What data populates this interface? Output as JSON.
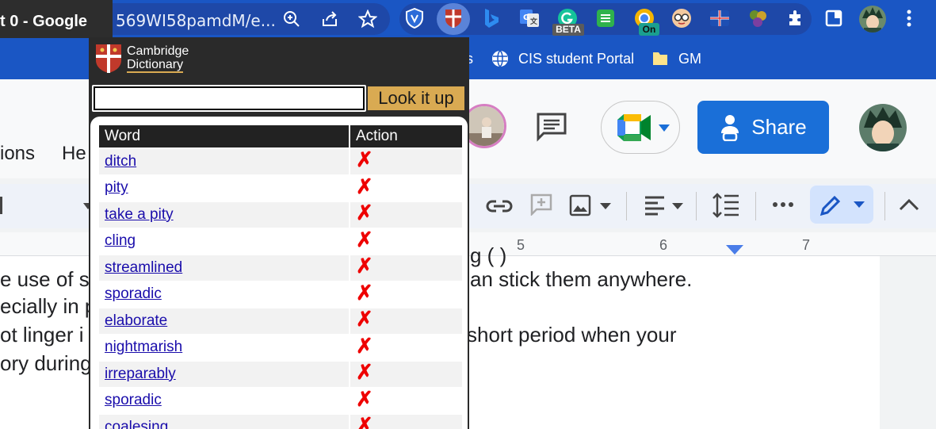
{
  "browser": {
    "tab_title": "t 0 - Google",
    "url_fragment": "569WI58pamdM/e...",
    "extension_badges": {
      "beta": "BETA",
      "on": "On"
    }
  },
  "bookmarks": [
    {
      "label": "s"
    },
    {
      "label": "CIS student Portal",
      "icon": "globe-icon"
    },
    {
      "label": "GM",
      "icon": "folder-icon"
    }
  ],
  "docs": {
    "menu_fragments": [
      "ions",
      "He"
    ],
    "share_label": "Share",
    "ruler_numbers": [
      "5",
      "6",
      "7"
    ],
    "page_lines": [
      "e use of s",
      "ecially in p",
      "ot linger i",
      "ory during"
    ],
    "page_lines_right": [
      "g (                        )",
      "an stick them anywhere.",
      "short period when your"
    ]
  },
  "popup": {
    "brand_line1": "Cambridge",
    "brand_line2": "Dictionary",
    "search_value": "",
    "lookup_button": "Look it up",
    "table_headers": {
      "word": "Word",
      "action": "Action"
    },
    "words": [
      "ditch",
      "pity",
      "take a pity",
      "cling",
      "streamlined",
      "sporadic",
      "elaborate",
      "nightmarish",
      "irreparably",
      "sporadic",
      "coalesing"
    ],
    "delete_glyph": "✗"
  },
  "colors": {
    "chrome_blue": "#1a56c4",
    "popup_dark": "#2a2a2a",
    "lookup_gold": "#d9aa52",
    "share_blue": "#1a6fd8",
    "delete_red": "#e00000"
  }
}
